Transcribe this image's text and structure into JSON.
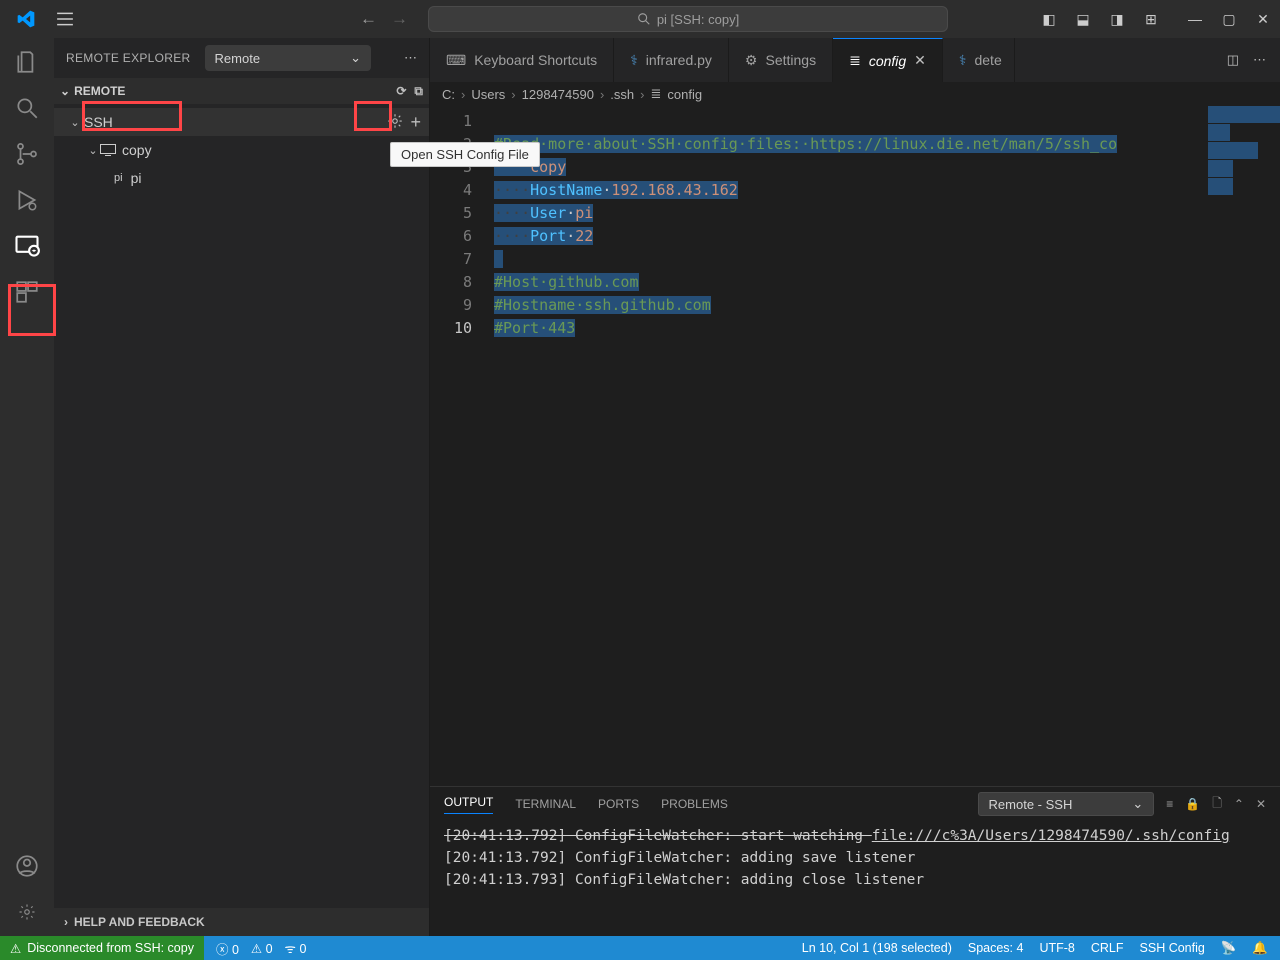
{
  "title_bar": {
    "search_text": "pi [SSH: copy]"
  },
  "sidebar": {
    "title": "REMOTE EXPLORER",
    "dropdown": "Remote",
    "section": "REMOTE",
    "footer": "HELP AND FEEDBACK",
    "tree": {
      "ssh": "SSH",
      "copy": "copy",
      "pi": "pi",
      "pi_desc": "pi"
    }
  },
  "tabs": {
    "t1": "Keyboard Shortcuts",
    "t2": "infrared.py",
    "t3": "Settings",
    "t4": "config",
    "t5": "dete"
  },
  "breadcrumb": {
    "p1": "C:",
    "p2": "Users",
    "p3": "1298474590",
    "p4": ".ssh",
    "p5": "config"
  },
  "tooltip": "Open SSH Config File",
  "code": {
    "l1_comment": "#Read·more·about·SSH·config·files:·https://linux.die.net/man/5/ssh_co",
    "l2_val": "copy",
    "l3_key": "HostName",
    "l3_val": "192.168.43.162",
    "l4_key": "User",
    "l4_val": "pi",
    "l5_key": "Port",
    "l5_val": "22",
    "l7": "#Host·github.com",
    "l8": "#Hostname·ssh.github.com",
    "l9": "#Port·443"
  },
  "panel": {
    "tab1": "OUTPUT",
    "tab2": "TERMINAL",
    "tab3": "PORTS",
    "tab4": "PROBLEMS",
    "source": "Remote - SSH",
    "log0a": "[20:41:13.792] ConfigFileWatcher: start watching ",
    "log0b": "file:///c%3A/Users/1298474590/.ssh/config",
    "log1": "[20:41:13.792] ConfigFileWatcher: adding save listener",
    "log2": "[20:41:13.793] ConfigFileWatcher: adding close listener"
  },
  "status": {
    "remote": "Disconnected from SSH: copy",
    "errors": "0",
    "warnings": "0",
    "ports": "0",
    "cursor": "Ln 10, Col 1 (198 selected)",
    "spaces": "Spaces: 4",
    "encoding": "UTF-8",
    "eol": "CRLF",
    "lang": "SSH Config"
  }
}
